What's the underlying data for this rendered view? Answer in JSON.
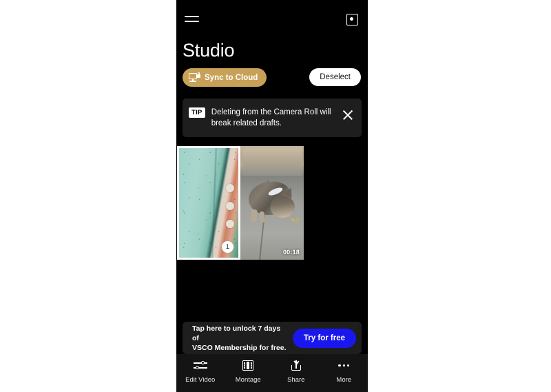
{
  "header": {
    "menu_icon": "hamburger-menu-icon",
    "capture_icon": "camera-capture-icon",
    "title": "Studio"
  },
  "actions": {
    "sync_label": "Sync to Cloud",
    "sync_icon": "monitor-lock-icon",
    "sync_bg_color": "#c8a158",
    "deselect_label": "Deselect"
  },
  "tip": {
    "badge": "TIP",
    "message": "Deleting from the Camera Roll will break related drafts.",
    "close_icon": "close-x-icon"
  },
  "grid": {
    "items": [
      {
        "type": "photo",
        "selected": true,
        "selection_number": "1",
        "duration": ""
      },
      {
        "type": "video",
        "selected": false,
        "selection_number": "",
        "duration": "00:18"
      }
    ]
  },
  "promo": {
    "line1": "Tap here to unlock 7 days of",
    "line2": "VSCO Membership for free.",
    "button_label": "Try for free",
    "button_color": "#1a17ee"
  },
  "bottom_nav": {
    "items": [
      {
        "label": "Edit Video",
        "icon": "sliders-icon"
      },
      {
        "label": "Montage",
        "icon": "film-strip-icon"
      },
      {
        "label": "Share",
        "icon": "share-upload-icon"
      },
      {
        "label": "More",
        "icon": "more-dots-icon"
      }
    ]
  }
}
